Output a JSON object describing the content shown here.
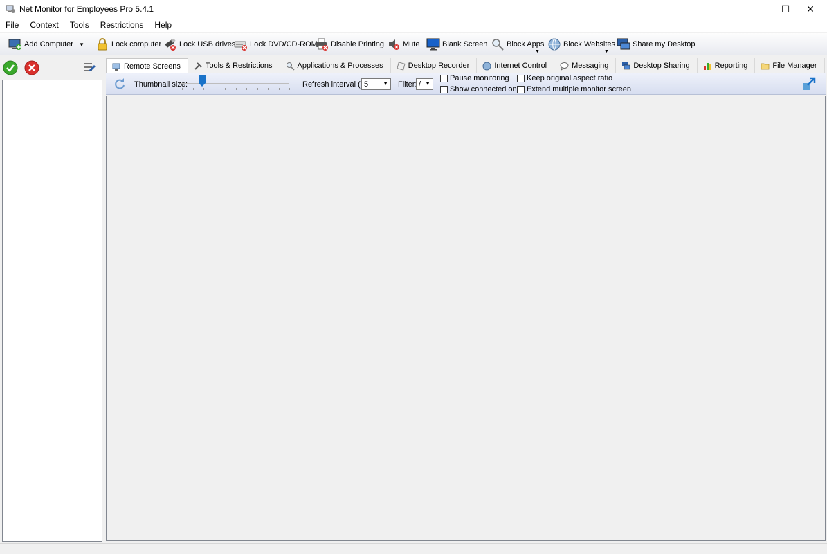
{
  "window": {
    "title": "Net Monitor for Employees Pro 5.4.1",
    "minimize": "—",
    "maximize": "☐",
    "close": "✕"
  },
  "menu": [
    "File",
    "Context",
    "Tools",
    "Restrictions",
    "Help"
  ],
  "toolbar": {
    "add_computer": "Add Computer",
    "lock_computer": "Lock computer",
    "lock_usb": "Lock USB drives",
    "lock_dvd": "Lock DVD/CD-ROM",
    "disable_printing": "Disable Printing",
    "mute": "Mute",
    "blank_screen": "Blank Screen",
    "block_apps": "Block Apps",
    "block_websites": "Block Websites",
    "share_desktop": "Share my Desktop"
  },
  "tabs": [
    "Remote Screens",
    "Tools & Restrictions",
    "Applications & Processes",
    "Desktop Recorder",
    "Internet Control",
    "Messaging",
    "Desktop Sharing",
    "Reporting",
    "File Manager"
  ],
  "options": {
    "thumbnail_label": "Thumbnail size:",
    "refresh_label": "Refresh interval (s):",
    "refresh_value": "5",
    "filter_label": "Filter:",
    "filter_value": "/",
    "pause_monitoring": "Pause monitoring",
    "show_connected_only": "Show connected only",
    "keep_aspect_ratio": "Keep original aspect ratio",
    "extend_multi_monitor": "Extend multiple monitor screen"
  },
  "colors": {
    "accent_blue": "#1a73c9",
    "ok_green": "#3aa82b",
    "cancel_red": "#d9302c"
  }
}
